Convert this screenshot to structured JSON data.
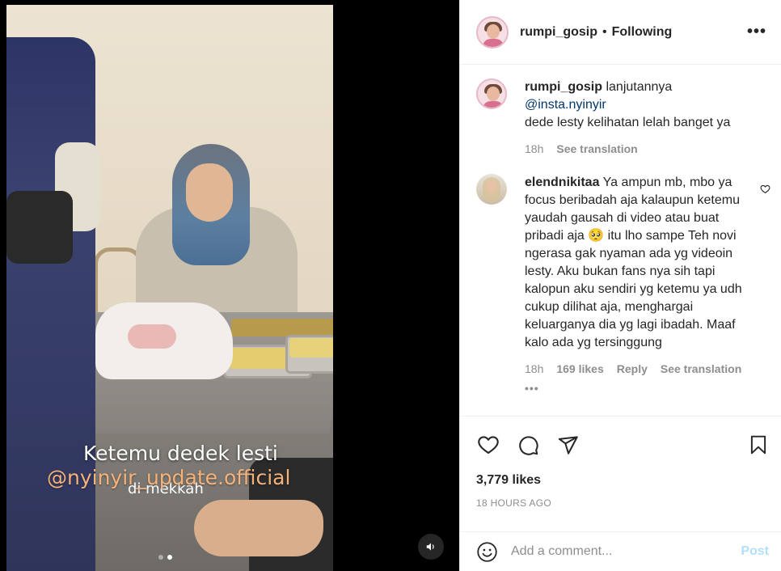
{
  "header": {
    "username": "rumpi_gosip",
    "separator": "•",
    "follow_status": "Following",
    "more_glyph": "•••"
  },
  "media": {
    "caption_line1": "Ketemu dedek lesti",
    "caption_line2": "@nyinyir_update.official",
    "caption_line3": "di mekkah",
    "carousel_dots": 2,
    "active_dot": 2,
    "audio_icon": "speaker-icon"
  },
  "caption": {
    "username": "rumpi_gosip",
    "text_before": " lanjutannya",
    "mention": "@insta.nyinyir",
    "text_after": "dede lesty kelihatan lelah banget ya",
    "time": "18h",
    "see_translation": "See translation"
  },
  "comment": {
    "username": "elendnikitaa",
    "text": " Ya ampun mb, mbo ya focus beribadah aja kalaupun ketemu yaudah gausah di video atau buat pribadi aja 🥺 itu lho sampe Teh novi ngerasa gak nyaman ada yg videoin lesty. Aku bukan fans nya sih tapi kalopun aku sendiri yg ketemu ya udh cukup dilihat aja, menghargai keluarganya dia yg lagi ibadah. Maaf kalo ada yg tersinggung",
    "time": "18h",
    "likes": "169 likes",
    "reply": "Reply",
    "see_translation": "See translation",
    "more_glyph": "•••"
  },
  "actions": {
    "like_icon": "heart-icon",
    "comment_icon": "comment-icon",
    "share_icon": "send-icon",
    "save_icon": "bookmark-icon"
  },
  "post": {
    "likes": "3,779 likes",
    "time_ago": "18 HOURS AGO"
  },
  "add_comment": {
    "placeholder": "Add a comment...",
    "post_label": "Post"
  },
  "colors": {
    "text": "#262626",
    "secondary": "#8e8e8e",
    "link": "#00376b",
    "post_disabled": "#b2dffc"
  }
}
